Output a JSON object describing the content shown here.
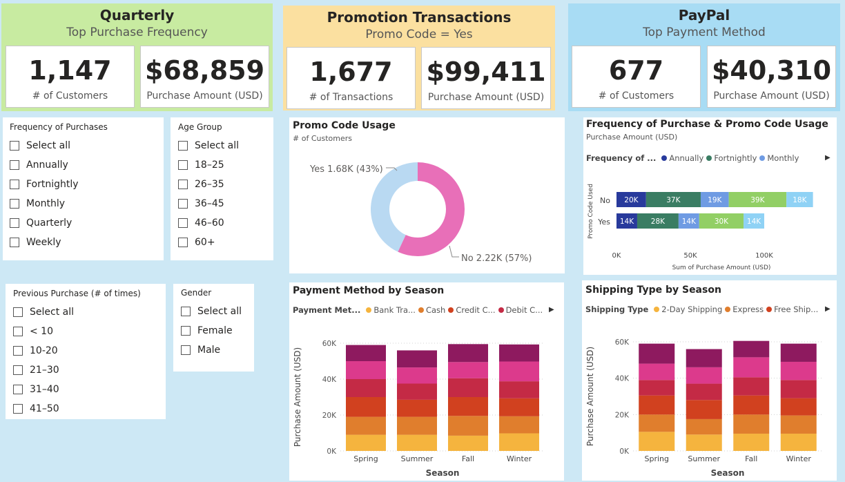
{
  "kpi_sections": [
    {
      "title": "Quarterly",
      "subtitle": "Top Purchase Frequency",
      "header_color": "#c8eba1",
      "cards": [
        {
          "value": "1,147",
          "label": "# of Customers"
        },
        {
          "value": "$68,859",
          "label": "Purchase Amount (USD)"
        }
      ]
    },
    {
      "title": "Promotion Transactions",
      "subtitle": "Promo Code = Yes",
      "header_color": "#fbe0a0",
      "cards": [
        {
          "value": "1,677",
          "label": "# of Transactions"
        },
        {
          "value": "$99,411",
          "label": "Purchase Amount (USD)"
        }
      ]
    },
    {
      "title": "PayPal",
      "subtitle": "Top Payment Method",
      "header_color": "#a8dcf4",
      "cards": [
        {
          "value": "677",
          "label": "# of Customers"
        },
        {
          "value": "$40,310",
          "label": "Purchase Amount (USD)"
        }
      ]
    }
  ],
  "slicers": {
    "frequency": {
      "title": "Frequency of Purchases",
      "items": [
        "Select all",
        "Annually",
        "Fortnightly",
        "Monthly",
        "Quarterly",
        "Weekly"
      ]
    },
    "age_group": {
      "title": "Age Group",
      "items": [
        "Select all",
        "18–25",
        "26–35",
        "36–45",
        "46–60",
        "60+"
      ]
    },
    "previous_purchase": {
      "title": "Previous Purchase (# of times)",
      "items": [
        "Select all",
        "< 10",
        "10-20",
        "21–30",
        "31–40",
        "41–50"
      ]
    },
    "gender": {
      "title": "Gender",
      "items": [
        "Select all",
        "Female",
        "Male"
      ]
    }
  },
  "promo_usage": {
    "title": "Promo Code Usage",
    "subtitle": "# of Customers",
    "label_yes": "Yes 1.68K (43%)",
    "label_no": "No 2.22K (57%)"
  },
  "freq_promo": {
    "title": "Frequency of Purchase & Promo Code Usage",
    "subtitle": "Purchase Amount (USD)",
    "legend_title": "Frequency of ...",
    "legend_items": [
      "Annually",
      "Fortnightly",
      "Monthly"
    ],
    "y_axis_title": "Promo Code Used",
    "x_axis_title": "Sum of Purchase Amount (USD)",
    "x_ticks": [
      "0K",
      "50K",
      "100K"
    ]
  },
  "payment_season": {
    "title": "Payment Method by Season",
    "legend_title": "Payment Met...",
    "legend_items": [
      "Bank Tra...",
      "Cash",
      "Credit C...",
      "Debit C..."
    ],
    "y_axis_title": "Purchase Amount (USD)",
    "x_axis_title": "Season"
  },
  "shipping_season": {
    "title": "Shipping Type by Season",
    "legend_title": "Shipping Type",
    "legend_items": [
      "2-Day Shipping",
      "Express",
      "Free Ship..."
    ],
    "y_axis_title": "Purchase Amount (USD)",
    "x_axis_title": "Season"
  },
  "chart_data": [
    {
      "type": "pie",
      "title": "Promo Code Usage",
      "subtitle": "# of Customers",
      "categories": [
        "No",
        "Yes"
      ],
      "values": [
        2220,
        1680
      ],
      "percents": [
        57,
        43
      ],
      "colors": [
        "#e86fb8",
        "#b9d9f2"
      ]
    },
    {
      "type": "bar",
      "orientation": "horizontal",
      "stacked": true,
      "title": "Frequency of Purchase & Promo Code Usage",
      "categories": [
        "No",
        "Yes"
      ],
      "series": [
        {
          "name": "Annually",
          "values": [
            20,
            14
          ],
          "color": "#283a9c"
        },
        {
          "name": "Fortnightly",
          "values": [
            37,
            28
          ],
          "color": "#3a7d63"
        },
        {
          "name": "Monthly",
          "values": [
            19,
            14
          ],
          "color": "#6f9be3"
        },
        {
          "values": [
            39,
            30
          ],
          "color": "#92cf65"
        },
        {
          "values": [
            18,
            14
          ],
          "color": "#8fd2f5"
        }
      ],
      "data_labels": [
        [
          "20K",
          "37K",
          "19K",
          "39K",
          "18K"
        ],
        [
          "14K",
          "28K",
          "14K",
          "30K",
          "14K"
        ]
      ],
      "xlabel": "Sum of Purchase Amount (USD)",
      "ylabel": "Promo Code Used",
      "xlim": [
        0,
        135
      ],
      "x_ticks": [
        0,
        50,
        100
      ],
      "x_tick_labels": [
        "0K",
        "50K",
        "100K"
      ]
    },
    {
      "type": "bar",
      "stacked": true,
      "title": "Payment Method by Season",
      "categories": [
        "Spring",
        "Summer",
        "Fall",
        "Winter"
      ],
      "series": [
        {
          "name": "Bank Tra...",
          "values": [
            9,
            9,
            8.5,
            9.8
          ],
          "color": "#f5b43e"
        },
        {
          "name": "Cash",
          "values": [
            10,
            10,
            11,
            9.5
          ],
          "color": "#e07e2d"
        },
        {
          "name": "Credit C...",
          "values": [
            11,
            9.5,
            10.5,
            10
          ],
          "color": "#d1411f"
        },
        {
          "name": "Debit C...",
          "values": [
            10,
            9,
            10.5,
            9.5
          ],
          "color": "#c42a45"
        },
        {
          "values": [
            10,
            9,
            9,
            11
          ],
          "color": "#dc3a8c"
        },
        {
          "values": [
            9,
            9.5,
            10,
            9.5
          ],
          "color": "#8e1a5f"
        }
      ],
      "xlabel": "Season",
      "ylabel": "Purchase Amount (USD)",
      "ylim": [
        0,
        60
      ],
      "y_ticks": [
        0,
        20,
        40,
        60
      ],
      "y_tick_labels": [
        "0K",
        "20K",
        "40K",
        "60K"
      ]
    },
    {
      "type": "bar",
      "stacked": true,
      "title": "Shipping Type by Season",
      "categories": [
        "Spring",
        "Summer",
        "Fall",
        "Winter"
      ],
      "series": [
        {
          "name": "2-Day Shipping",
          "values": [
            10.5,
            9,
            9.5,
            9.5
          ],
          "color": "#f5b43e"
        },
        {
          "name": "Express",
          "values": [
            9.5,
            8.5,
            10.5,
            10
          ],
          "color": "#e07e2d"
        },
        {
          "name": "Free Ship...",
          "values": [
            10.5,
            10.5,
            10.5,
            9.5
          ],
          "color": "#d1411f"
        },
        {
          "values": [
            8.5,
            9,
            10,
            10
          ],
          "color": "#c42a45"
        },
        {
          "values": [
            9,
            9,
            11,
            10
          ],
          "color": "#dc3a8c"
        },
        {
          "values": [
            11,
            10,
            9,
            10
          ],
          "color": "#8e1a5f"
        }
      ],
      "xlabel": "Season",
      "ylabel": "Purchase Amount (USD)",
      "ylim": [
        0,
        60
      ],
      "y_ticks": [
        0,
        20,
        40,
        60
      ],
      "y_tick_labels": [
        "0K",
        "20K",
        "40K",
        "60K"
      ]
    }
  ]
}
